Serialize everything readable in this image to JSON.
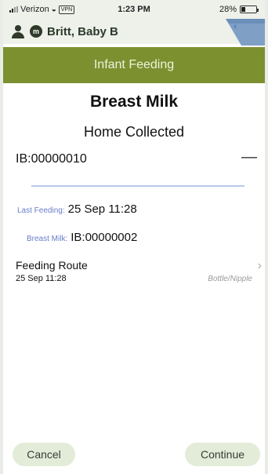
{
  "status_bar": {
    "carrier": "Verizon",
    "vpn": "VPN",
    "time": "1:23 PM",
    "battery": "28%",
    "battery_level": 0.28
  },
  "patient": {
    "badge": "m",
    "name": "Britt, Baby B"
  },
  "header": {
    "title": "Infant Feeding"
  },
  "feeding": {
    "milk_type": "Breast Milk",
    "source": "Home Collected",
    "barcode": "IB:00000010",
    "collapse_symbol": "—",
    "last_feeding_label": "Last Feeding:",
    "last_feeding_value": "25 Sep 11:28",
    "breast_milk_label": "Breast Milk:",
    "breast_milk_value": "IB:00000002"
  },
  "route": {
    "title": "Feeding Route",
    "date": "25 Sep 11:28",
    "value": "Bottle/Nipple"
  },
  "footer": {
    "cancel_label": "Cancel",
    "continue_label": "Continue"
  },
  "colors": {
    "accent_green": "#7c9030",
    "link_blue": "#6a7ec9",
    "divider_blue": "#b9c8ee",
    "button_bg": "#e3ecd8"
  }
}
